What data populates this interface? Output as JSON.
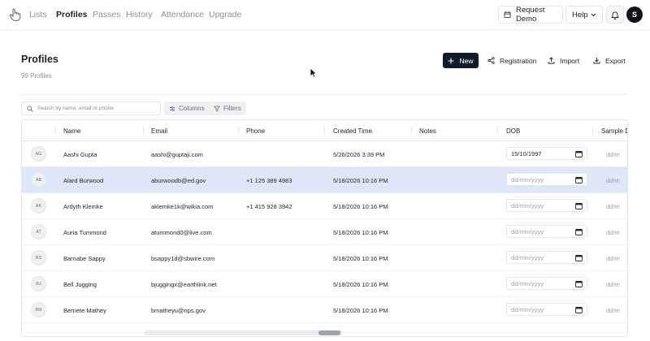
{
  "nav": {
    "links": [
      "Lists",
      "Profiles",
      "Passes",
      "History",
      "Attendance",
      "Upgrade"
    ],
    "active": "Profiles",
    "request_demo_label": "Request Demo",
    "help_label": "Help",
    "avatar_initial": "S"
  },
  "header": {
    "title": "Profiles",
    "count_text": "99 Profiles",
    "new_label": "New",
    "registration_label": "Registration",
    "import_label": "Import",
    "export_label": "Export"
  },
  "toolbar": {
    "search_placeholder": "Search by name, email or phone",
    "columns_label": "Columns",
    "filters_label": "Filters"
  },
  "table": {
    "columns": [
      "Name",
      "Email",
      "Phone",
      "Created Time",
      "Notes",
      "DOB",
      "Sample D"
    ],
    "date_placeholder": "dd/mm/yyyy",
    "sample_placeholder": "dd/m",
    "rows": [
      {
        "initials": "AG",
        "name": "Aashi Gupta",
        "email": "aashi@guptaji.com",
        "phone": "",
        "created": "5/26/2026 3:39 PM",
        "notes": "",
        "dob": "15/10/1997",
        "selected": false
      },
      {
        "initials": "AB",
        "name": "Alard Burwood",
        "email": "aburwoodb@ed.gov",
        "phone": "+1 125 389 4983",
        "created": "5/18/2026 10:16 PM",
        "notes": "",
        "dob": "",
        "selected": true
      },
      {
        "initials": "AK",
        "name": "Ardyth Klemke",
        "email": "aklemke1k@wikia.com",
        "phone": "+1 415 928 3942",
        "created": "5/18/2026 10:16 PM",
        "notes": "",
        "dob": "",
        "selected": false
      },
      {
        "initials": "AT",
        "name": "Auria Tummond",
        "email": "atummond0@live.com",
        "phone": "",
        "created": "5/18/2026 10:16 PM",
        "notes": "",
        "dob": "",
        "selected": false
      },
      {
        "initials": "BS",
        "name": "Barnabe Sappy",
        "email": "bsappy1d@sbwire.com",
        "phone": "",
        "created": "5/18/2026 10:16 PM",
        "notes": "",
        "dob": "",
        "selected": false
      },
      {
        "initials": "BJ",
        "name": "Bell Jugging",
        "email": "bjuggingx@earthlink.net",
        "phone": "",
        "created": "5/18/2026 10:16 PM",
        "notes": "",
        "dob": "",
        "selected": false
      },
      {
        "initials": "BM",
        "name": "Bernete Mathey",
        "email": "bmatheyu@nps.gov",
        "phone": "",
        "created": "5/18/2026 10:16 PM",
        "notes": "",
        "dob": "",
        "selected": false
      }
    ]
  },
  "colors": {
    "primary_button": "#101d2c",
    "selected_row": "#dde7f7",
    "muted_text": "#8a8f98"
  }
}
